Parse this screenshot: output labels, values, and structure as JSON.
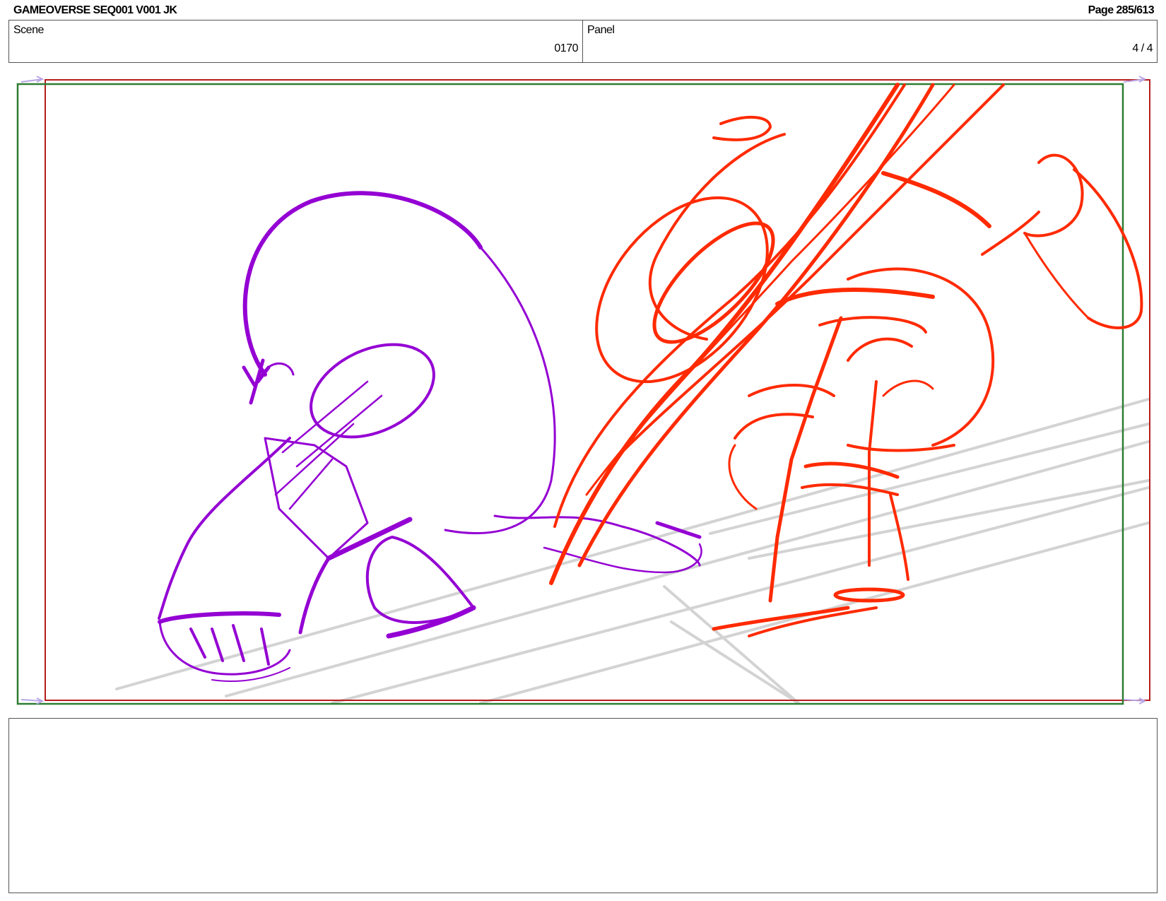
{
  "header": {
    "title": "GAMEOVERSE SEQ001 V001 JK",
    "page": "Page 285/613"
  },
  "info": {
    "scene_label": "Scene",
    "scene_value": "0170",
    "panel_label": "Panel",
    "panel_value": "4 / 4"
  },
  "colors": {
    "safe_frame": "#2e7d32",
    "camera_frame": "#b71c1c",
    "character_left": "#9400d3",
    "character_right": "#ff2a00",
    "perspective_lines": "#d0d0d0"
  },
  "notes": {
    "text": ""
  }
}
